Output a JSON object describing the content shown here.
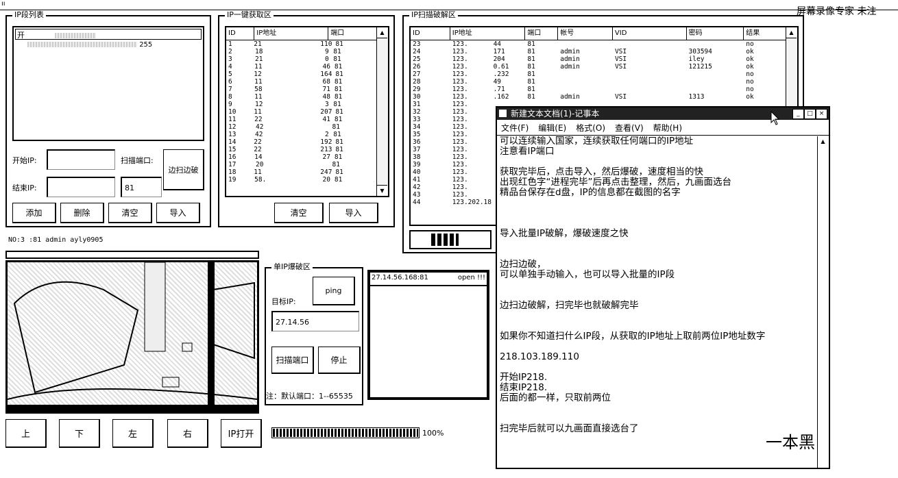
{
  "titlebar": {
    "left_glyph": "ıı",
    "right_text": "屏幕录像专家 未注"
  },
  "ip_list_panel": {
    "title": "IP段列表",
    "items": [
      {
        "text": "开"
      },
      {
        "text": "255"
      }
    ],
    "start_ip_label": "开始IP:",
    "end_ip_label": "结束IP:",
    "scan_port_label": "扫描端口:",
    "port_value": "81",
    "scan_crack_button": "边扫边破",
    "add_button": "添加",
    "delete_button": "删除",
    "clear_button": "清空",
    "import_button": "导入"
  },
  "ip_fetch_panel": {
    "title": "IP一键获取区",
    "columns": [
      "ID",
      "IP地址",
      "端口"
    ],
    "rows": [
      {
        "id": "1",
        "ip": "21",
        "tail": "110",
        "port": "81"
      },
      {
        "id": "2",
        "ip": "18",
        "tail": "9",
        "port": "81"
      },
      {
        "id": "3",
        "ip": "21",
        "tail": "0",
        "port": "81"
      },
      {
        "id": "4",
        "ip": "11",
        "tail": "46",
        "port": "81"
      },
      {
        "id": "5",
        "ip": "12",
        "tail": "164",
        "port": "81"
      },
      {
        "id": "6",
        "ip": "11",
        "tail": "68",
        "port": "81"
      },
      {
        "id": "7",
        "ip": "58",
        "tail": "71",
        "port": "81"
      },
      {
        "id": "8",
        "ip": "11",
        "tail": "48",
        "port": "81"
      },
      {
        "id": "9",
        "ip": "12",
        "tail": "3",
        "port": "81"
      },
      {
        "id": "10",
        "ip": "11",
        "tail": "207",
        "port": "81"
      },
      {
        "id": "11",
        "ip": "22",
        "tail": "41",
        "port": "81"
      },
      {
        "id": "12",
        "ip": "42",
        "tail": "",
        "port": "81"
      },
      {
        "id": "13",
        "ip": "42",
        "tail": "2",
        "port": "81"
      },
      {
        "id": "14",
        "ip": "22",
        "tail": "192",
        "port": "81"
      },
      {
        "id": "15",
        "ip": "22",
        "tail": "213",
        "port": "81"
      },
      {
        "id": "16",
        "ip": "14",
        "tail": "27",
        "port": "81"
      },
      {
        "id": "17",
        "ip": "20",
        "tail": "",
        "port": "81"
      },
      {
        "id": "18",
        "ip": "11",
        "tail": "247",
        "port": "81"
      },
      {
        "id": "19",
        "ip": "58.",
        "tail": "20",
        "port": "81"
      }
    ],
    "clear_button": "清空",
    "import_button": "导入"
  },
  "ip_crack_panel": {
    "title": "IP扫描破解区",
    "columns": [
      "ID",
      "IP地址",
      "端口",
      "帐号",
      "VID",
      "密码",
      "结果"
    ],
    "rows": [
      {
        "id": "23",
        "ip": "123.",
        "tail": "44",
        "port": "81",
        "user": "",
        "vid": "",
        "pass": "",
        "result": "no"
      },
      {
        "id": "24",
        "ip": "123.",
        "tail": "171",
        "port": "81",
        "user": "admin",
        "vid": "VSI",
        "pass": "303594",
        "result": "ok"
      },
      {
        "id": "25",
        "ip": "123.",
        "tail": "204",
        "port": "81",
        "user": "admin",
        "vid": "VSI",
        "pass": "iley",
        "result": "ok"
      },
      {
        "id": "26",
        "ip": "123.",
        "tail": "0.61",
        "port": "81",
        "user": "admin",
        "vid": "VSI",
        "pass": "121215",
        "result": "ok"
      },
      {
        "id": "27",
        "ip": "123.",
        "tail": ".232",
        "port": "81",
        "user": "",
        "vid": "",
        "pass": "",
        "result": "no"
      },
      {
        "id": "28",
        "ip": "123.",
        "tail": "49",
        "port": "81",
        "user": "",
        "vid": "",
        "pass": "",
        "result": "no"
      },
      {
        "id": "29",
        "ip": "123.",
        "tail": ".71",
        "port": "81",
        "user": "",
        "vid": "",
        "pass": "",
        "result": "no"
      },
      {
        "id": "30",
        "ip": "123.",
        "tail": ".162",
        "port": "81",
        "user": "admin",
        "vid": "VSI",
        "pass": "1313",
        "result": "ok"
      },
      {
        "id": "31",
        "ip": "123.",
        "tail": "",
        "port": "",
        "user": "",
        "vid": "",
        "pass": "",
        "result": ""
      },
      {
        "id": "32",
        "ip": "123.",
        "tail": "",
        "port": "",
        "user": "",
        "vid": "",
        "pass": "",
        "result": ""
      },
      {
        "id": "33",
        "ip": "123.",
        "tail": "",
        "port": "",
        "user": "",
        "vid": "",
        "pass": "",
        "result": ""
      },
      {
        "id": "34",
        "ip": "123.",
        "tail": "",
        "port": "",
        "user": "",
        "vid": "",
        "pass": "",
        "result": ""
      },
      {
        "id": "35",
        "ip": "123.",
        "tail": "",
        "port": "",
        "user": "",
        "vid": "",
        "pass": "",
        "result": ""
      },
      {
        "id": "36",
        "ip": "123.",
        "tail": "",
        "port": "",
        "user": "",
        "vid": "",
        "pass": "",
        "result": ""
      },
      {
        "id": "37",
        "ip": "123.",
        "tail": "",
        "port": "",
        "user": "",
        "vid": "",
        "pass": "",
        "result": ""
      },
      {
        "id": "38",
        "ip": "123.",
        "tail": "",
        "port": "",
        "user": "",
        "vid": "",
        "pass": "",
        "result": ""
      },
      {
        "id": "39",
        "ip": "123.",
        "tail": "",
        "port": "",
        "user": "",
        "vid": "",
        "pass": "",
        "result": ""
      },
      {
        "id": "40",
        "ip": "123.",
        "tail": "",
        "port": "",
        "user": "",
        "vid": "",
        "pass": "",
        "result": ""
      },
      {
        "id": "41",
        "ip": "123.",
        "tail": "",
        "port": "",
        "user": "",
        "vid": "",
        "pass": "",
        "result": ""
      },
      {
        "id": "42",
        "ip": "123.",
        "tail": "",
        "port": "",
        "user": "",
        "vid": "",
        "pass": "",
        "result": ""
      },
      {
        "id": "43",
        "ip": "123.",
        "tail": "",
        "port": "",
        "user": "",
        "vid": "",
        "pass": "",
        "result": ""
      },
      {
        "id": "44",
        "ip": "123.202.18",
        "tail": "",
        "port": "",
        "user": "",
        "vid": "",
        "pass": "",
        "result": ""
      }
    ]
  },
  "status": {
    "text": "NO:3 :81 admin ayly0905"
  },
  "single_ip_panel": {
    "title": "单IP爆破区",
    "target_label": "目标IP:",
    "ping_button": "ping",
    "target_value": "27.14.56",
    "scan_port_button": "扫描端口",
    "stop_button": "停止",
    "note": "注：默认端口：1--65535",
    "result_line": "27.14.56.168:81",
    "result_status": "open !!!"
  },
  "direction_buttons": {
    "up": "上",
    "down": "下",
    "left": "左",
    "right": "右",
    "open": "IP打开"
  },
  "progress": {
    "value": 1.0,
    "label": "100%"
  },
  "notepad": {
    "title": "新建文本文档(1)-记事本",
    "menu": [
      "文件(F)",
      "编辑(E)",
      "格式(O)",
      "查看(V)",
      "帮助(H)"
    ],
    "lines": [
      "可以连续输入国家，连续获取任何端口的IP地址",
      "注意看IP端口",
      "",
      "获取完毕后，点击导入，然后爆破，速度相当的快",
      "出现红色字“进程完毕”后再点击整理，然后，九画面选台",
      "精品台保存在d盘，IP的信息都在截图的名字",
      "",
      "",
      "",
      "导入批量IP破解，爆破速度之快",
      "",
      "",
      "边扫边破，",
      "可以单独手动输入，也可以导入批量的IP段",
      "",
      "",
      "边扫边破解，扫完毕也就破解完毕",
      "",
      "",
      "如果你不知道扫什么IP段，从获取的IP地址上取前两位IP地址数字",
      "",
      "218.103.189.110",
      "",
      "开始IP218.",
      "结束IP218.",
      "后面的都一样，只取前两位",
      "",
      "",
      "扫完毕后就可以九画面直接选台了"
    ]
  },
  "watermark": {
    "text": "一本黑"
  }
}
